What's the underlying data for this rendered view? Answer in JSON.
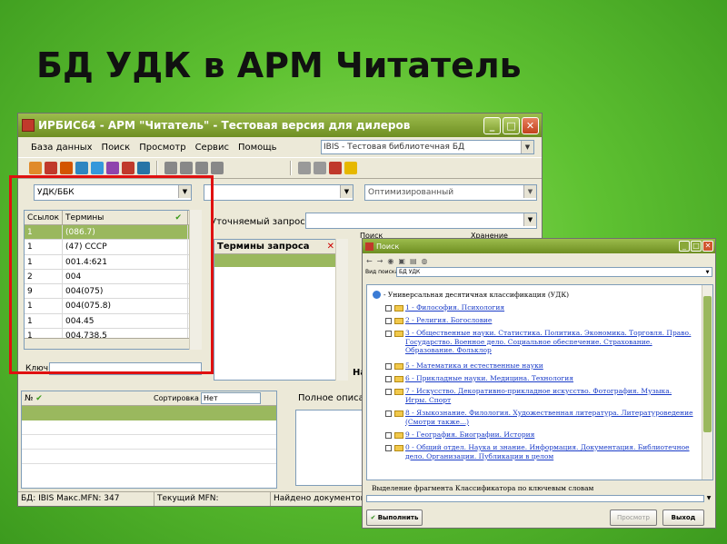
{
  "slide": {
    "title": "БД УДК в АРМ Читатель"
  },
  "window": {
    "title": "ИРБИС64 - АРМ \"Читатель\" - Тестовая версия для дилеров",
    "menu": [
      "База данных",
      "Поиск",
      "Просмотр",
      "Сервис",
      "Помощь"
    ],
    "db_select": "IBIS - Тестовая библиотечная БД",
    "dictionary_select": "УДК/ББК",
    "mode_select": "Оптимизированный",
    "refine_label": "Уточняемый запрос:",
    "terms": {
      "headers": [
        "Ссылок",
        "Термины"
      ],
      "rows": [
        {
          "count": "1",
          "term": "(086.7)"
        },
        {
          "count": "1",
          "term": "(47) СССР"
        },
        {
          "count": "1",
          "term": "001.4:621"
        },
        {
          "count": "2",
          "term": "004"
        },
        {
          "count": "9",
          "term": "004(075)"
        },
        {
          "count": "1",
          "term": "004(075.8)"
        },
        {
          "count": "1",
          "term": "004.45"
        },
        {
          "count": "1",
          "term": "004.738.5"
        }
      ]
    },
    "query_terms_header": "Термины запроса",
    "key_label": "Ключ",
    "docs": {
      "num_header": "№",
      "sort_label": "Сортировка",
      "sort_value": "Нет"
    },
    "full_desc_label": "Полное описан",
    "na_label": "На",
    "partial_headers": [
      "Поиск",
      "Хранение"
    ],
    "status": {
      "db": "БД: IBIS Макс.MFN: 347",
      "mfn": "Текущий MFN:",
      "found": "Найдено документов"
    }
  },
  "popup": {
    "title": "Поиск",
    "dict_label": "Вид поиска:",
    "dict_value": "БД УДК",
    "root": "- Универсальная десятичная классификация (УДК)",
    "items": [
      "1 - Философия. Психология",
      "2 - Религия. Богословие",
      "3 - Общественные науки. Статистика. Политика. Экономика. Торговля. Право. Государство. Военное дело. Социальное обеспечение. Страхование. Образование. Фольклор",
      "5 - Математика и естественные науки",
      "6 - Прикладные науки. Медицина. Технология",
      "7 - Искусство. Декоративно-прикладное искусство. Фотография. Музыка. Игры. Спорт",
      "8 - Языкознание. Филология. Художественная литература. Литературоведение (Смотри также...)",
      "9 - География. Биографии. История",
      "0 - Общий отдел. Наука и знание. Информация. Документация. Библиотечное дело. Организации. Публикации в целом"
    ],
    "hint": "Выделение фрагмента Классификатора по ключевым словам",
    "btn_execute": "Выполнить",
    "btn_view": "Просмотр",
    "btn_exit": "Выход"
  }
}
